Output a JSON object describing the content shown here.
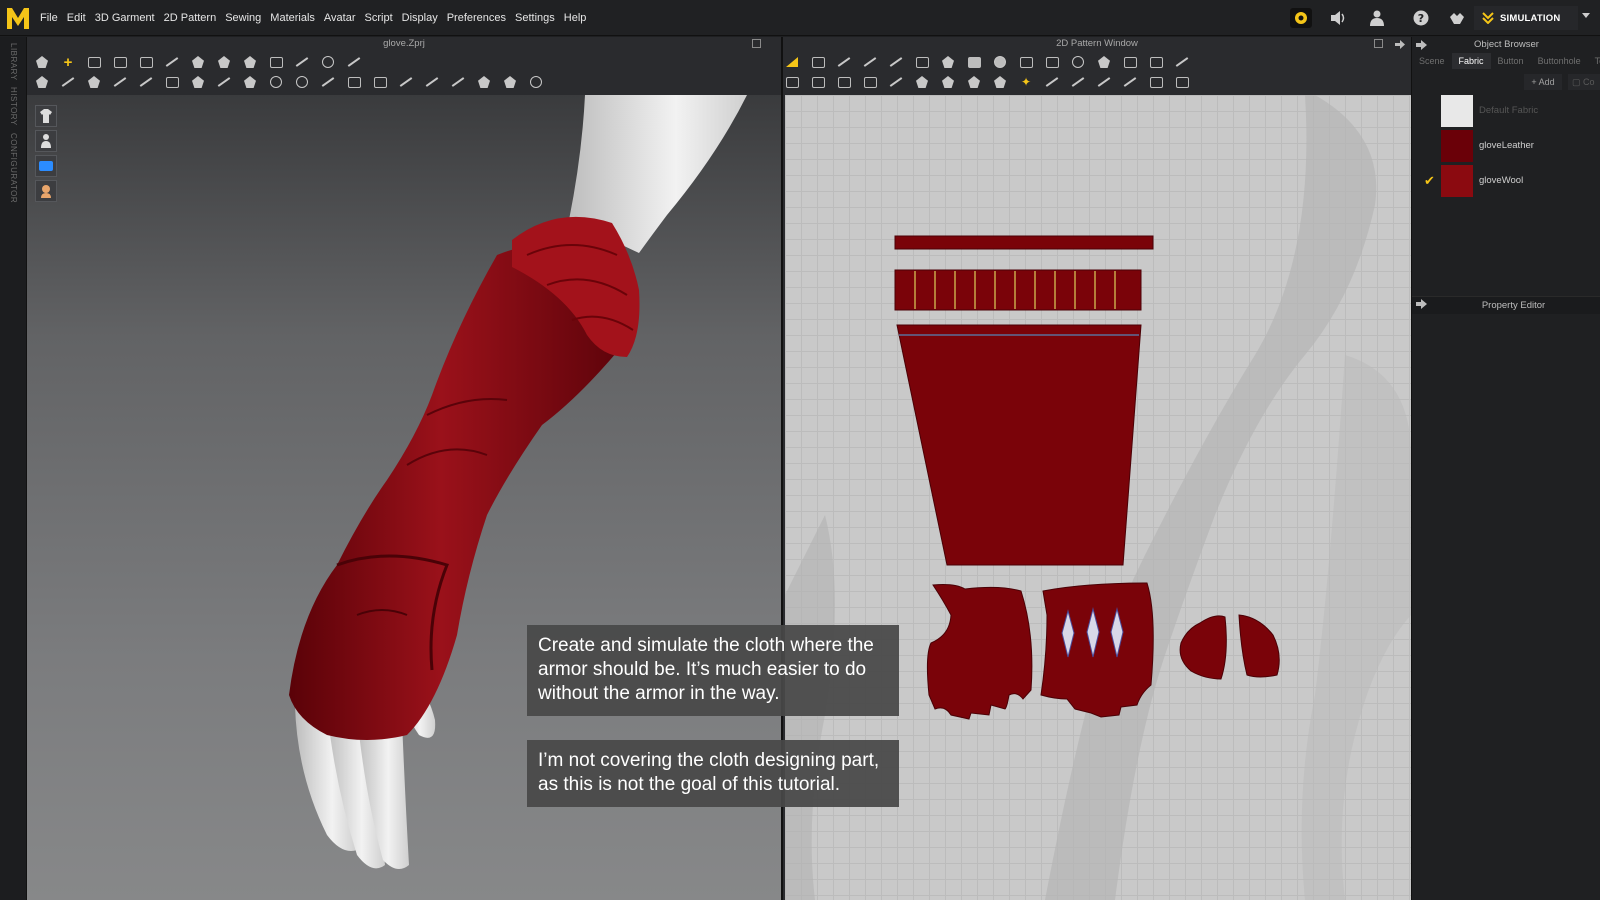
{
  "app": {
    "logo_letter": "M"
  },
  "menu": [
    "File",
    "Edit",
    "3D Garment",
    "2D Pattern",
    "Sewing",
    "Materials",
    "Avatar",
    "Script",
    "Display",
    "Preferences",
    "Settings",
    "Help"
  ],
  "topbar": {
    "icons": [
      "cloud-icon",
      "speaker-icon",
      "user-icon",
      "help-icon",
      "connect-icon"
    ],
    "mode_button": "SIMULATION",
    "accent": "#f5c518"
  },
  "left_tabs": [
    "LIBRARY",
    "HISTORY",
    "CONFIGURATOR"
  ],
  "window3d": {
    "title": "glove.Zprj"
  },
  "window2d": {
    "title": "2D Pattern Window"
  },
  "object_browser": {
    "title": "Object Browser",
    "tabs": [
      "Scene",
      "Fabric",
      "Button",
      "Buttonhole",
      "Topst"
    ],
    "active_tab": "Fabric",
    "add_label": "+ Add",
    "secondary_label": "Co",
    "fabrics": [
      {
        "name": "Default Fabric",
        "color": "#e8e8e8",
        "selected": false,
        "dim": true
      },
      {
        "name": "gloveLeather",
        "color": "#6a0008",
        "selected": false,
        "dim": false
      },
      {
        "name": "gloveWool",
        "color": "#8b0a10",
        "selected": true,
        "dim": false
      }
    ],
    "check_mark": "✔"
  },
  "property_editor": {
    "title": "Property Editor"
  },
  "captions": [
    {
      "text": "Create and simulate the cloth where the armor should be. It’s much easier to do without the armor in the way."
    },
    {
      "text": "I’m not covering the cloth designing part, as this is not the goal of this tutorial."
    }
  ],
  "colors": {
    "garment_red": "#8e0b12",
    "pattern_red": "#7a0309",
    "seam_yellow": "#c9a74a",
    "skin": "#efefef"
  }
}
